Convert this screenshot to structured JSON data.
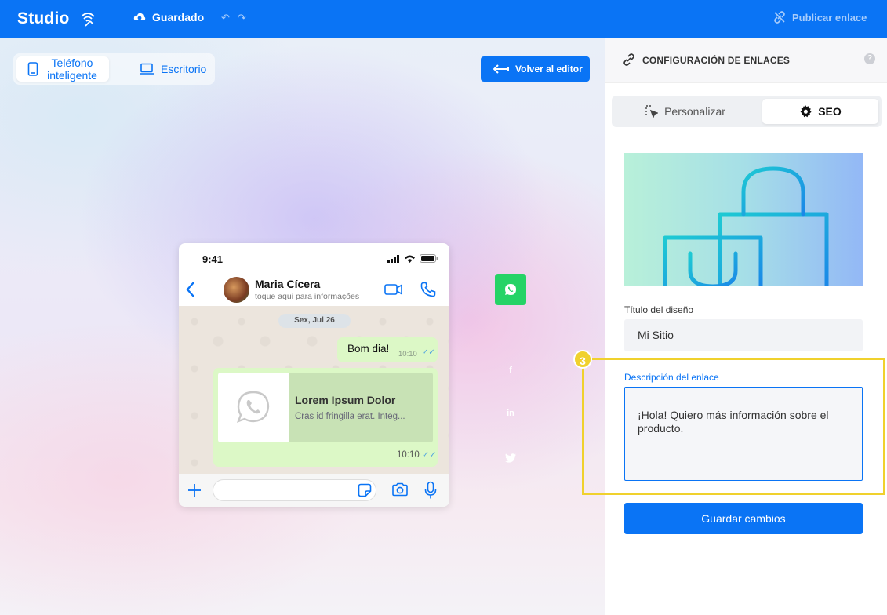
{
  "topbar": {
    "logo": "Studio",
    "logo_icon": "wifi-hand-icon",
    "saved_label": "Guardado",
    "publish_label": "Publicar enlace",
    "accent_color": "#0a74f5"
  },
  "canvas": {
    "device_toggle": {
      "phone_label": "Teléfono inteligente",
      "desktop_label": "Escritorio",
      "selected": "phone"
    },
    "back_to_editor_label": "Volver al editor",
    "phone_preview": {
      "status_time": "9:41",
      "contact_name": "Maria Cícera",
      "contact_sub": "toque aqui para informações",
      "date_pill": "Sex, Jul 26",
      "message_1": {
        "text": "Bom dia!",
        "time": "10:10"
      },
      "message_2": {
        "link_title": "Lorem Ipsum Dolor",
        "link_desc": "Cras id fringilla erat. Integ...",
        "time": "10:10"
      }
    },
    "social_icons": [
      "whatsapp-icon",
      "facebook-icon",
      "linkedin-icon",
      "twitter-icon"
    ]
  },
  "panel": {
    "title": "CONFIGURACIÓN DE ENLACES",
    "help": "?",
    "tabs": [
      {
        "label": "Personalizar",
        "active": false
      },
      {
        "label": "SEO",
        "active": true
      }
    ],
    "design_title_label": "Título del diseño",
    "design_title_value": "Mi Sitio",
    "step_badge": "3",
    "link_description_label": "Descripción del enlace",
    "link_description_value": "¡Hola! Quiero más información sobre el producto.",
    "save_label": "Guardar cambios",
    "highlight_color": "#f0d12d"
  }
}
